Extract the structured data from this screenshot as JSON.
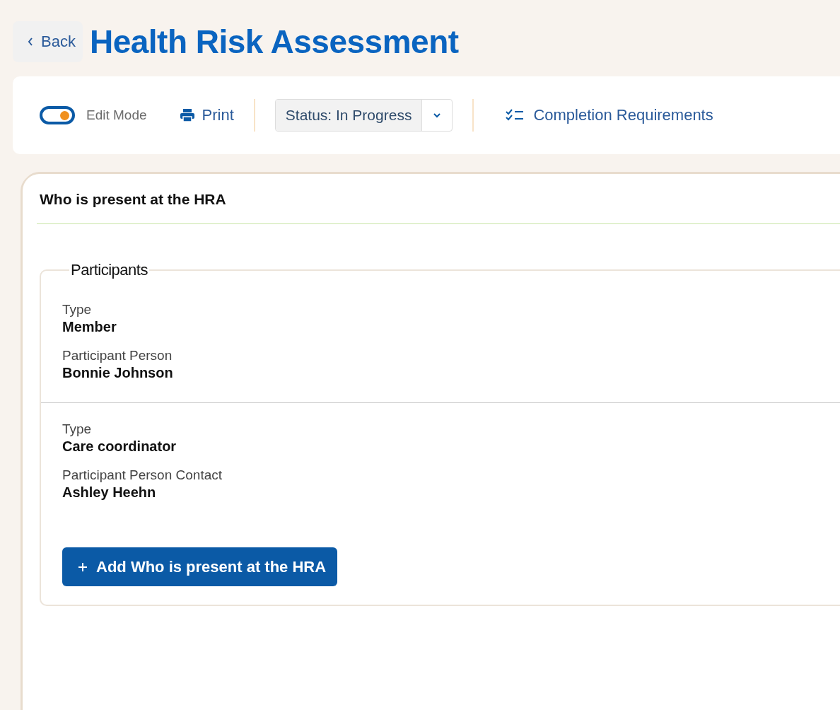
{
  "header": {
    "back_label": "Back",
    "title": "Health Risk Assessment"
  },
  "toolbar": {
    "edit_mode": {
      "label": "Edit Mode",
      "on": true
    },
    "print_label": "Print",
    "status": {
      "value": "Status: In Progress"
    },
    "completion_label": "Completion Requirements"
  },
  "section": {
    "title": "Who is present at the HRA",
    "fieldset_legend": "Participants",
    "participants": [
      {
        "fields": [
          {
            "label": "Type",
            "value": "Member"
          },
          {
            "label": "Participant Person",
            "value": "Bonnie Johnson"
          }
        ]
      },
      {
        "fields": [
          {
            "label": "Type",
            "value": "Care coordinator"
          },
          {
            "label": "Participant Person Contact",
            "value": "Ashley Heehn"
          }
        ]
      }
    ],
    "add_button": "Add Who is present at the HRA"
  }
}
